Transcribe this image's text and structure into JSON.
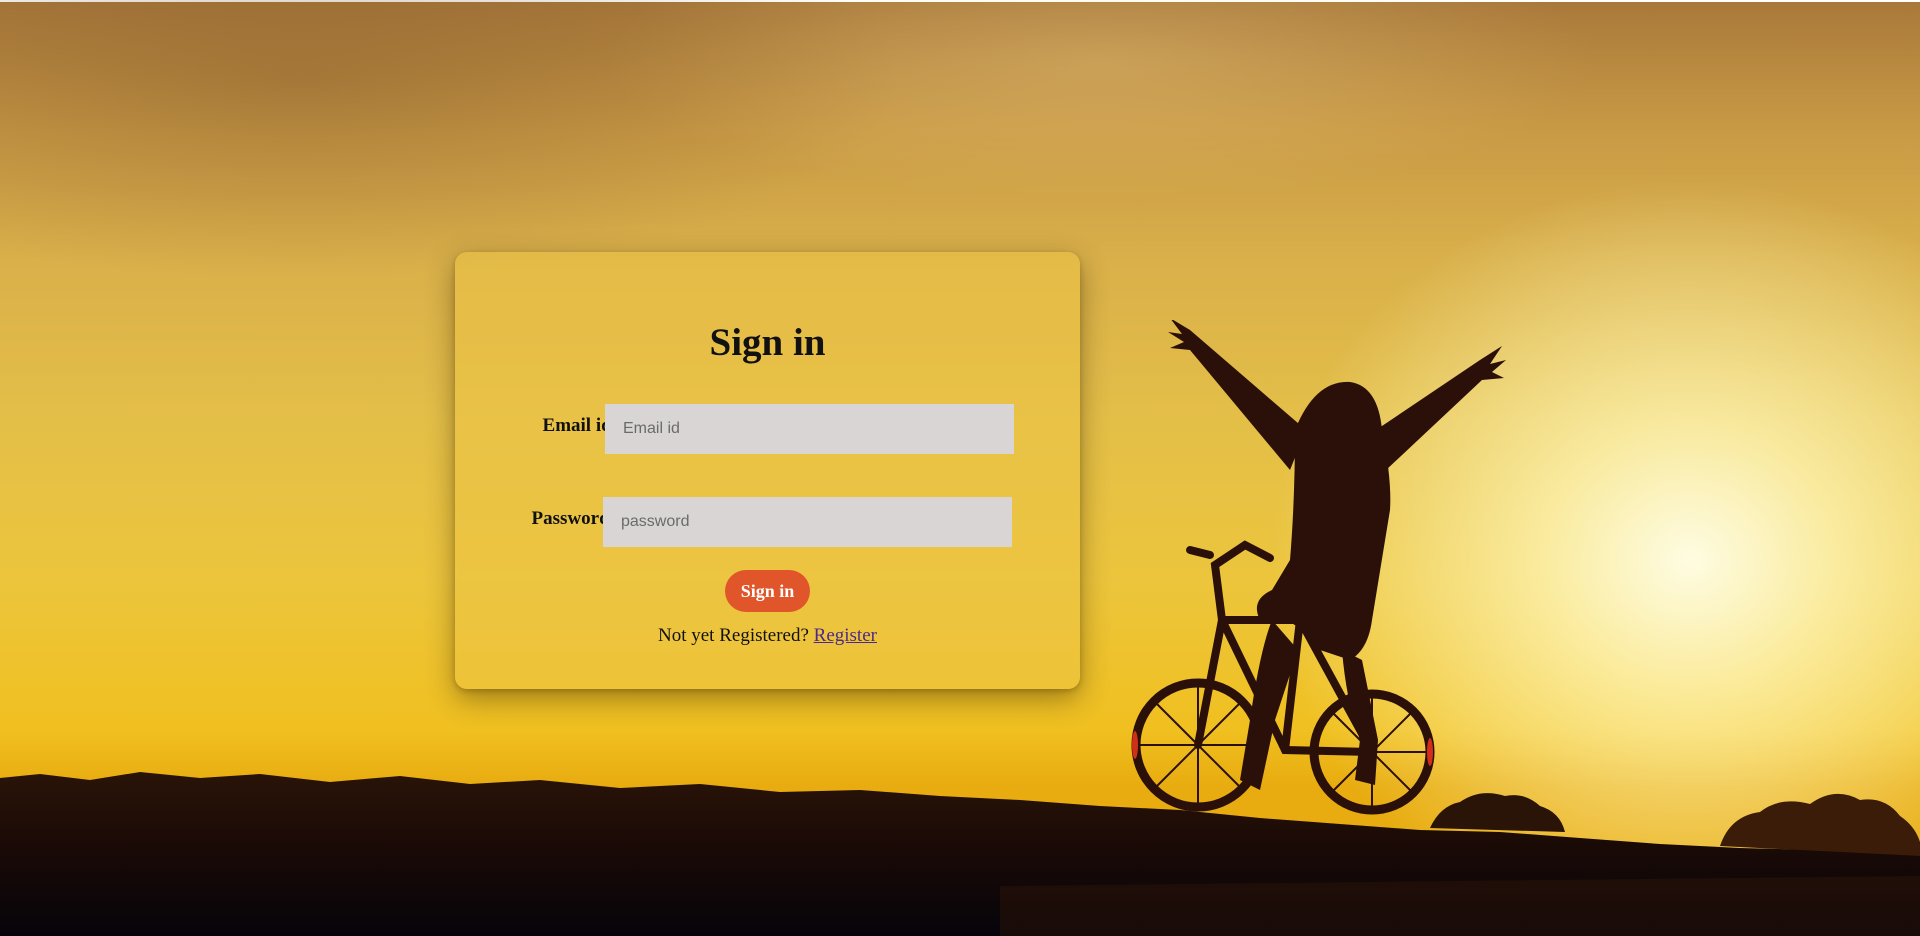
{
  "login": {
    "title": "Sign in",
    "email_label": "Email id:",
    "email_placeholder": "Email id",
    "email_value": "",
    "password_label": "Password:",
    "password_placeholder": "password",
    "password_value": "",
    "submit_label": "Sign in",
    "register_prompt": "Not yet Registered?",
    "register_link": "Register"
  },
  "colors": {
    "button": "#e0552a",
    "input_bg": "#d8d5d4",
    "link": "#4b2a8a"
  },
  "icons": [
    "cyclist-silhouette-image"
  ]
}
